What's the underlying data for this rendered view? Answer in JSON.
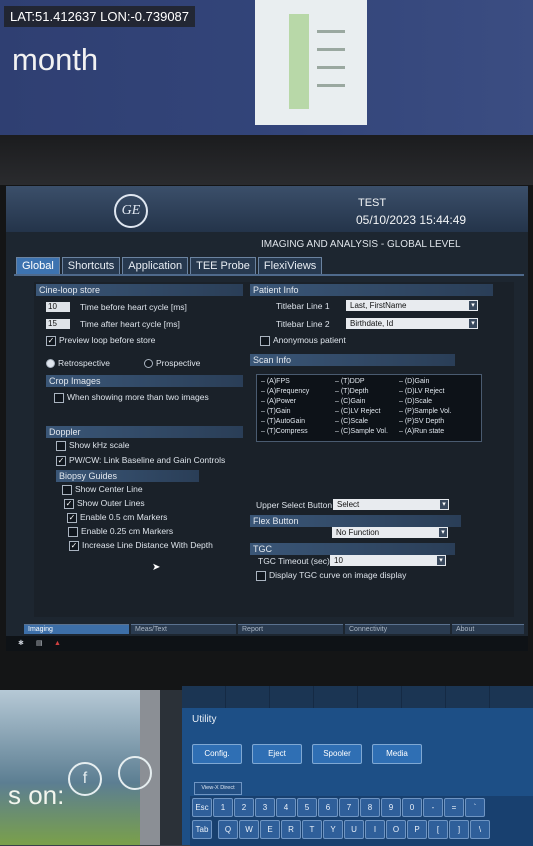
{
  "overlay": {
    "geotag": "LAT:51.412637 LON:-0.739087"
  },
  "background": {
    "wall_word": "month",
    "green_sign": "s on:"
  },
  "header": {
    "logo": "GE",
    "device_name": "TEST",
    "datetime": "05/10/2023 15:44:49",
    "level_title": "IMAGING AND ANALYSIS - GLOBAL LEVEL"
  },
  "tabs": [
    "Global",
    "Shortcuts",
    "Application",
    "TEE Probe",
    "FlexiViews"
  ],
  "active_tab": "Global",
  "cine_loop": {
    "title": "Cine-loop store",
    "before_value": "10",
    "before_label": "Time before heart cycle [ms]",
    "after_value": "15",
    "after_label": "Time after heart cycle [ms]",
    "preview_label": "Preview loop before store",
    "preview_checked": true,
    "retro_label": "Retrospective",
    "prosp_label": "Prospective"
  },
  "crop_images": {
    "title": "Crop Images",
    "option_label": "When showing more than two images"
  },
  "doppler": {
    "title": "Doppler",
    "khz_label": "Show kHz scale",
    "link_label": "PW/CW: Link Baseline and Gain Controls"
  },
  "biopsy": {
    "title": "Biopsy Guides",
    "center_line": "Show Center Line",
    "outer_lines": "Show Outer Lines",
    "m05": "Enable 0.5 cm Markers",
    "m025": "Enable 0.25 cm Markers",
    "increase": "Increase Line Distance With Depth"
  },
  "patient_info": {
    "title": "Patient Info",
    "line1_label": "Titlebar Line 1",
    "line1_value": "Last, FirstName",
    "line2_label": "Titlebar Line 2",
    "line2_value": "Birthdate, Id",
    "anon_label": "Anonymous patient"
  },
  "scan_info": {
    "title": "Scan Info",
    "items": [
      [
        "(A)FPS",
        "(T)DDP",
        "(D)Gain"
      ],
      [
        "(A)Frequency",
        "(T)Depth",
        "(D)LV Reject"
      ],
      [
        "(A)Power",
        "(C)Gain",
        "(D)Scale"
      ],
      [
        "(T)Gain",
        "(C)LV Reject",
        "(P)Sample Vol."
      ],
      [
        "(T)AutoGain",
        "(C)Scale",
        "(P)SV Depth"
      ],
      [
        "(T)Compress",
        "(C)Sample Vol.",
        "(A)Run state"
      ]
    ]
  },
  "upper_select": {
    "label": "Upper Select Button",
    "value": "Select"
  },
  "flex_button": {
    "title": "Flex Button",
    "value": "No Function"
  },
  "tgc": {
    "title": "TGC",
    "timeout_label": "TGC Timeout (sec)",
    "timeout_value": "10",
    "display_label": "Display TGC curve on image display"
  },
  "bottom_tabs": [
    "Imaging",
    "Meas/Text",
    "Report",
    "Connectivity",
    "About"
  ],
  "touch": {
    "title": "Utility",
    "buttons": [
      "Config.",
      "Eject",
      "Spooler",
      "Media"
    ],
    "view_direct": "View-X Direct",
    "keys_row1": [
      "Esc",
      "1",
      "2",
      "3",
      "4",
      "5",
      "6",
      "7",
      "8",
      "9",
      "0",
      "-",
      "=",
      "`"
    ],
    "keys_row2": [
      "Tab",
      "Q",
      "W",
      "E",
      "R",
      "T",
      "Y",
      "U",
      "I",
      "O",
      "P",
      "[",
      "]",
      "\\"
    ]
  }
}
